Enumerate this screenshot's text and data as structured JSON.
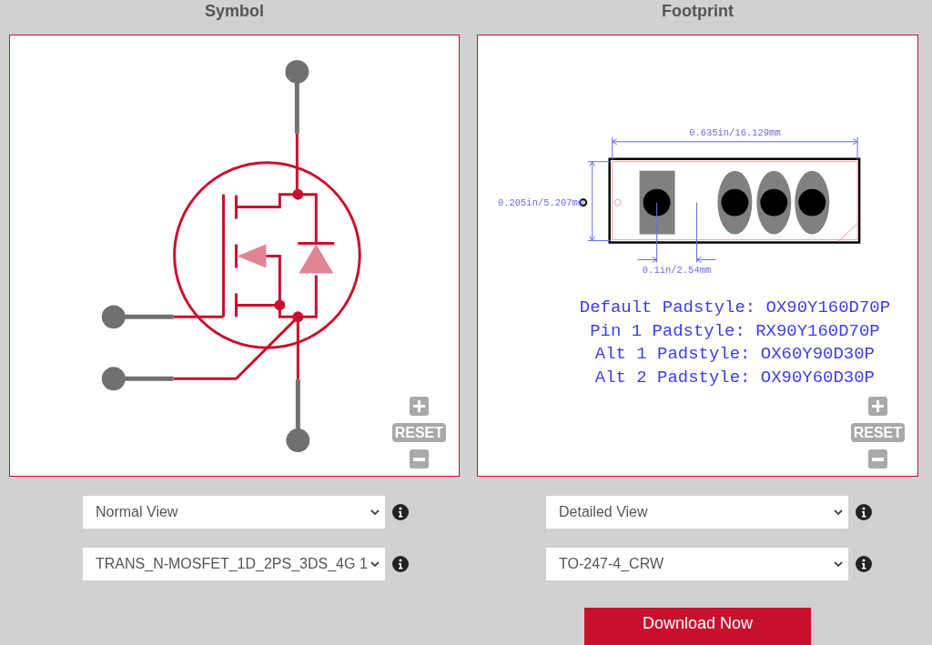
{
  "panels": [
    {
      "title": "Symbol",
      "kind": "symbol",
      "zoom": {
        "reset": "RESET"
      }
    },
    {
      "title": "Footprint",
      "kind": "footprint",
      "zoom": {
        "reset": "RESET"
      },
      "dimensions": {
        "width": "0.635in/16.129mm",
        "height": "0.205in/5.207mm",
        "pitch": "0.1in/2.54mm"
      },
      "padstyles": [
        "Default Padstyle: OX90Y160D70P",
        "Pin 1 Padstyle: RX90Y160D70P",
        "Alt 1 Padstyle: OX60Y90D30P",
        "Alt 2 Padstyle: OX90Y60D30P"
      ]
    }
  ],
  "controls": [
    {
      "selects": [
        {
          "value": "Normal View"
        },
        {
          "value": "TRANS_N-MOSFET_1D_2PS_3DS_4G 1"
        }
      ]
    },
    {
      "selects": [
        {
          "value": "Detailed View"
        },
        {
          "value": "TO-247-4_CRW"
        }
      ],
      "button": "Download Now"
    }
  ]
}
